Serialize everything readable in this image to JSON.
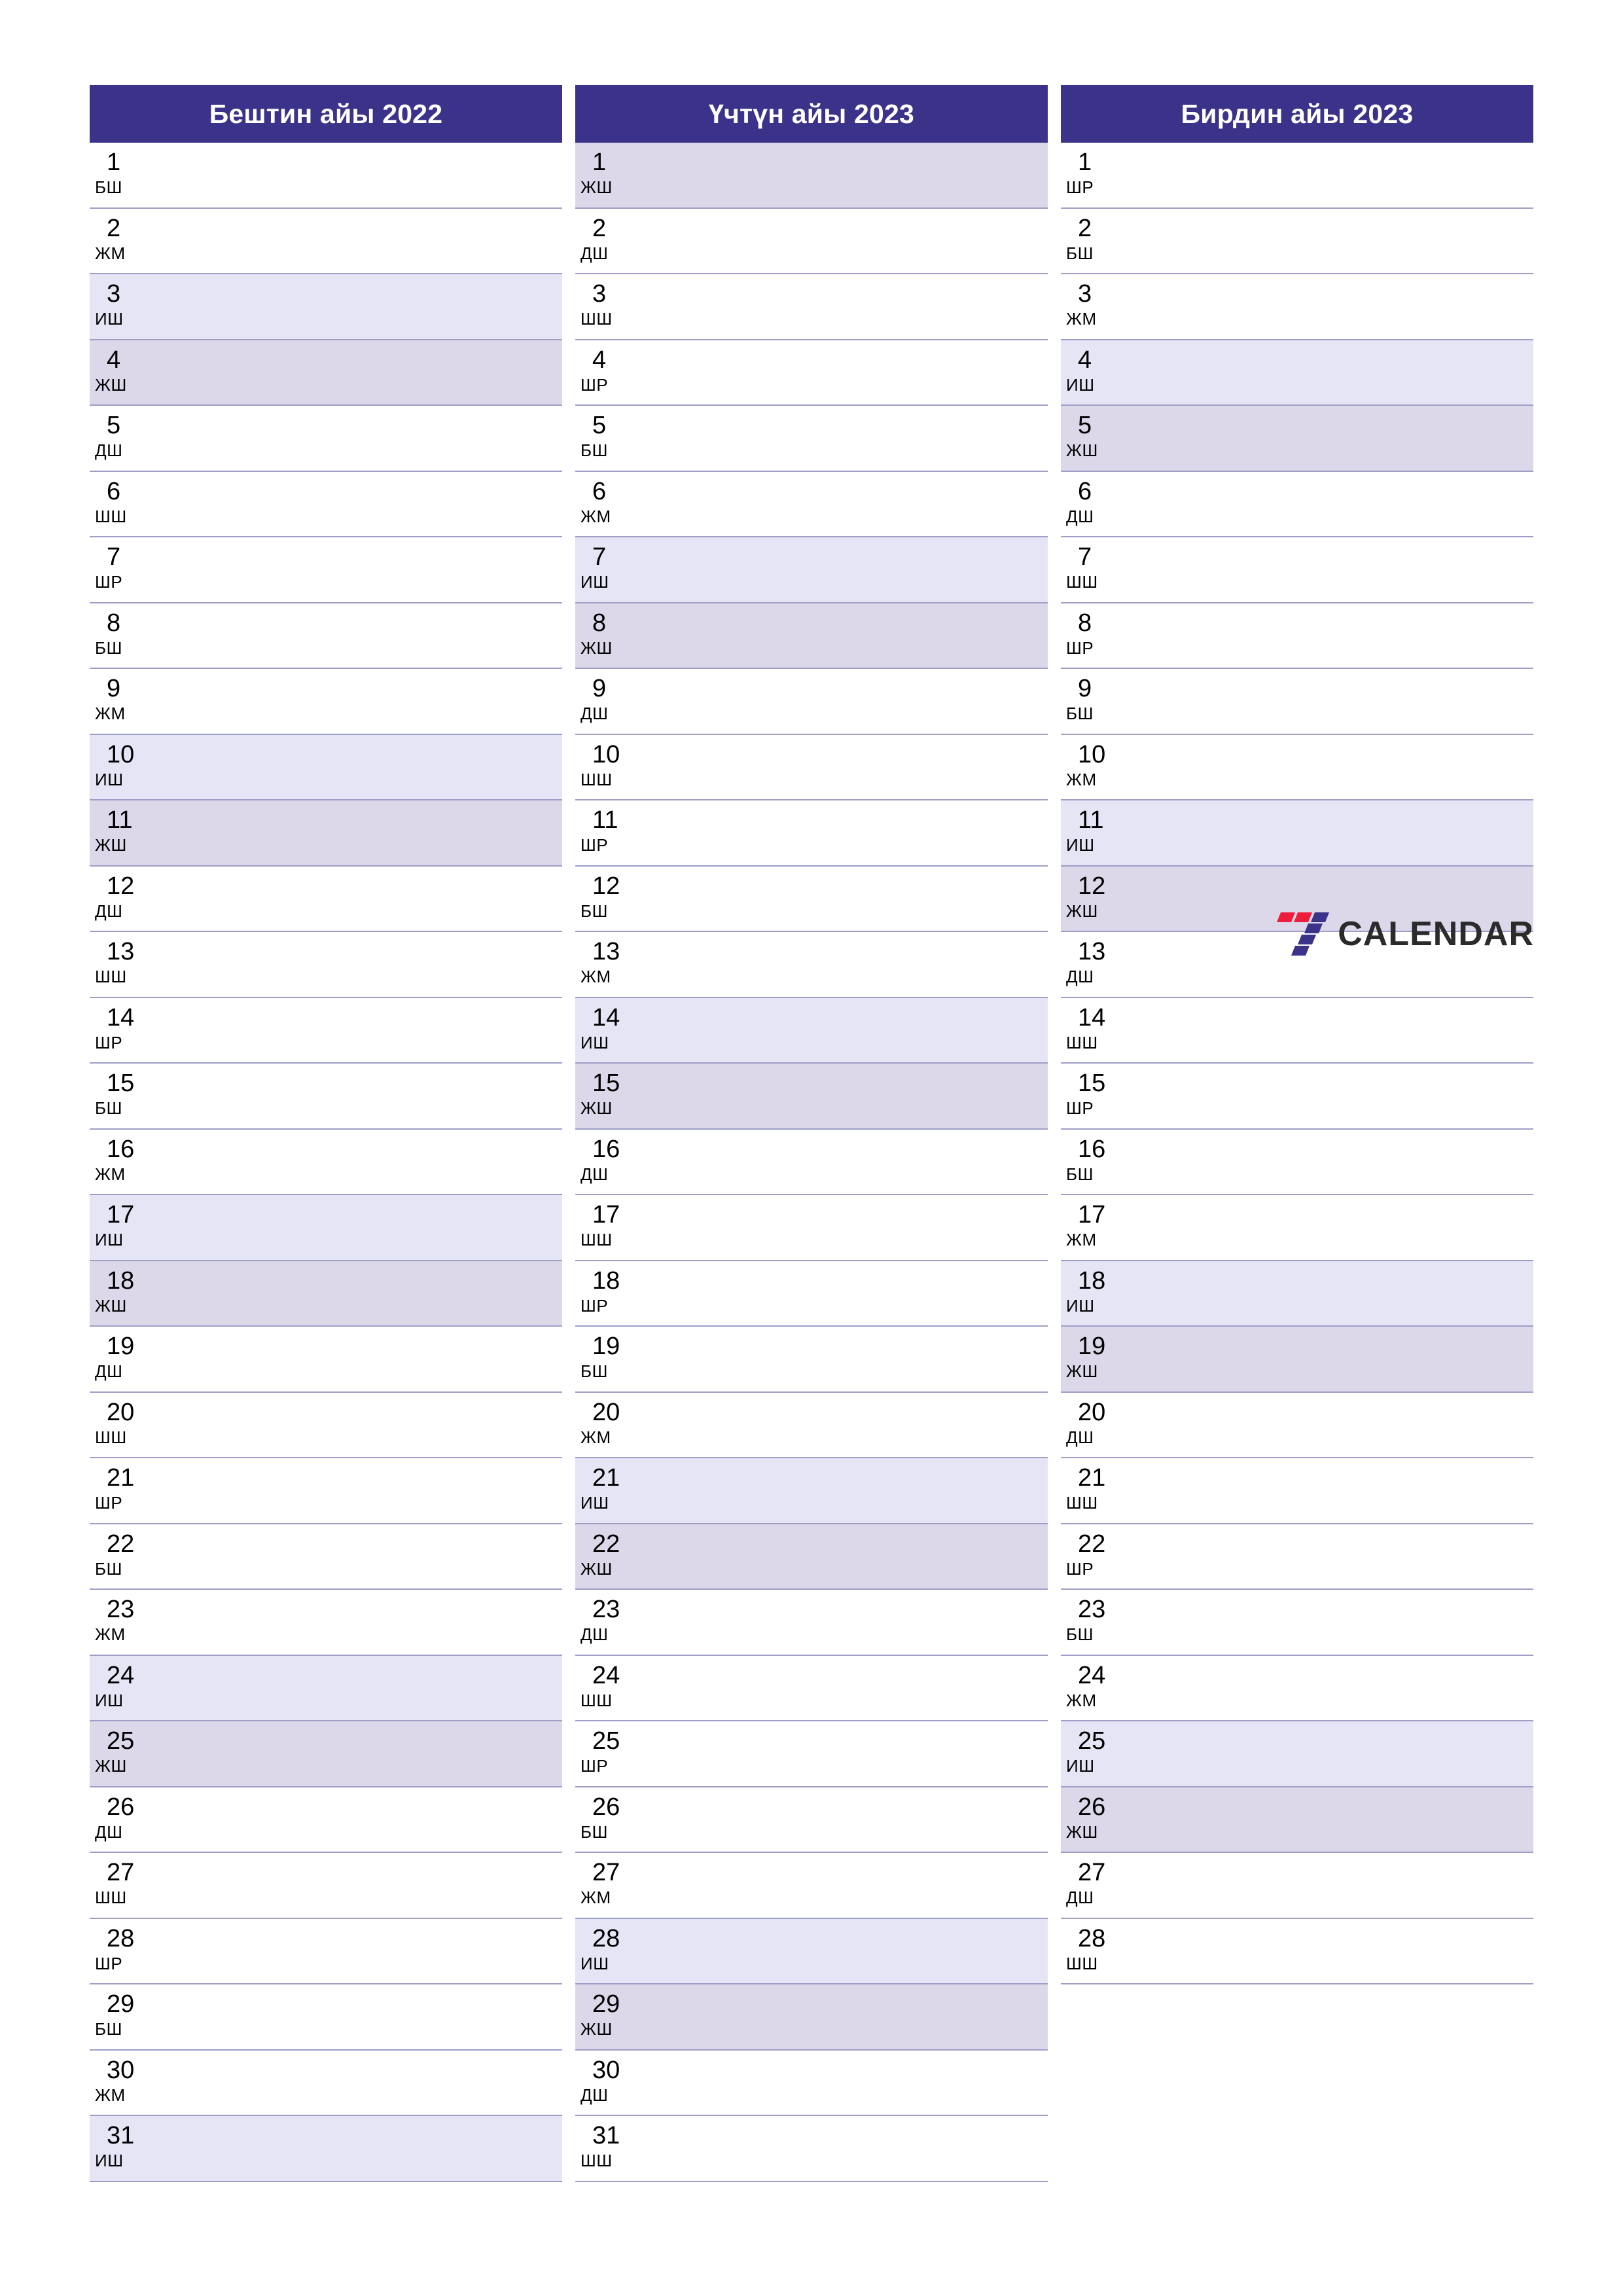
{
  "page": {
    "background": "#ffffff",
    "header_color": "#3b3289",
    "saturday_color": "#e5e5f6",
    "sunday_color": "#dcd8ea",
    "rule_color": "#9e9ec8"
  },
  "brand": {
    "name": "CALENDAR",
    "mark_name": "seven-logo-icon",
    "mark_colors": [
      "#ee1d3c",
      "#3b3289"
    ]
  },
  "months": [
    {
      "title": "Бештин айы 2022",
      "days": [
        {
          "num": "1",
          "abbr": "БШ",
          "type": "weekday"
        },
        {
          "num": "2",
          "abbr": "ЖМ",
          "type": "weekday"
        },
        {
          "num": "3",
          "abbr": "ИШ",
          "type": "sat"
        },
        {
          "num": "4",
          "abbr": "ЖШ",
          "type": "sun"
        },
        {
          "num": "5",
          "abbr": "ДШ",
          "type": "weekday"
        },
        {
          "num": "6",
          "abbr": "ШШ",
          "type": "weekday"
        },
        {
          "num": "7",
          "abbr": "ШР",
          "type": "weekday"
        },
        {
          "num": "8",
          "abbr": "БШ",
          "type": "weekday"
        },
        {
          "num": "9",
          "abbr": "ЖМ",
          "type": "weekday"
        },
        {
          "num": "10",
          "abbr": "ИШ",
          "type": "sat"
        },
        {
          "num": "11",
          "abbr": "ЖШ",
          "type": "sun"
        },
        {
          "num": "12",
          "abbr": "ДШ",
          "type": "weekday"
        },
        {
          "num": "13",
          "abbr": "ШШ",
          "type": "weekday"
        },
        {
          "num": "14",
          "abbr": "ШР",
          "type": "weekday"
        },
        {
          "num": "15",
          "abbr": "БШ",
          "type": "weekday"
        },
        {
          "num": "16",
          "abbr": "ЖМ",
          "type": "weekday"
        },
        {
          "num": "17",
          "abbr": "ИШ",
          "type": "sat"
        },
        {
          "num": "18",
          "abbr": "ЖШ",
          "type": "sun"
        },
        {
          "num": "19",
          "abbr": "ДШ",
          "type": "weekday"
        },
        {
          "num": "20",
          "abbr": "ШШ",
          "type": "weekday"
        },
        {
          "num": "21",
          "abbr": "ШР",
          "type": "weekday"
        },
        {
          "num": "22",
          "abbr": "БШ",
          "type": "weekday"
        },
        {
          "num": "23",
          "abbr": "ЖМ",
          "type": "weekday"
        },
        {
          "num": "24",
          "abbr": "ИШ",
          "type": "sat"
        },
        {
          "num": "25",
          "abbr": "ЖШ",
          "type": "sun"
        },
        {
          "num": "26",
          "abbr": "ДШ",
          "type": "weekday"
        },
        {
          "num": "27",
          "abbr": "ШШ",
          "type": "weekday"
        },
        {
          "num": "28",
          "abbr": "ШР",
          "type": "weekday"
        },
        {
          "num": "29",
          "abbr": "БШ",
          "type": "weekday"
        },
        {
          "num": "30",
          "abbr": "ЖМ",
          "type": "weekday"
        },
        {
          "num": "31",
          "abbr": "ИШ",
          "type": "sat"
        }
      ]
    },
    {
      "title": "Үчтүн айы 2023",
      "days": [
        {
          "num": "1",
          "abbr": "ЖШ",
          "type": "sun"
        },
        {
          "num": "2",
          "abbr": "ДШ",
          "type": "weekday"
        },
        {
          "num": "3",
          "abbr": "ШШ",
          "type": "weekday"
        },
        {
          "num": "4",
          "abbr": "ШР",
          "type": "weekday"
        },
        {
          "num": "5",
          "abbr": "БШ",
          "type": "weekday"
        },
        {
          "num": "6",
          "abbr": "ЖМ",
          "type": "weekday"
        },
        {
          "num": "7",
          "abbr": "ИШ",
          "type": "sat"
        },
        {
          "num": "8",
          "abbr": "ЖШ",
          "type": "sun"
        },
        {
          "num": "9",
          "abbr": "ДШ",
          "type": "weekday"
        },
        {
          "num": "10",
          "abbr": "ШШ",
          "type": "weekday"
        },
        {
          "num": "11",
          "abbr": "ШР",
          "type": "weekday"
        },
        {
          "num": "12",
          "abbr": "БШ",
          "type": "weekday"
        },
        {
          "num": "13",
          "abbr": "ЖМ",
          "type": "weekday"
        },
        {
          "num": "14",
          "abbr": "ИШ",
          "type": "sat"
        },
        {
          "num": "15",
          "abbr": "ЖШ",
          "type": "sun"
        },
        {
          "num": "16",
          "abbr": "ДШ",
          "type": "weekday"
        },
        {
          "num": "17",
          "abbr": "ШШ",
          "type": "weekday"
        },
        {
          "num": "18",
          "abbr": "ШР",
          "type": "weekday"
        },
        {
          "num": "19",
          "abbr": "БШ",
          "type": "weekday"
        },
        {
          "num": "20",
          "abbr": "ЖМ",
          "type": "weekday"
        },
        {
          "num": "21",
          "abbr": "ИШ",
          "type": "sat"
        },
        {
          "num": "22",
          "abbr": "ЖШ",
          "type": "sun"
        },
        {
          "num": "23",
          "abbr": "ДШ",
          "type": "weekday"
        },
        {
          "num": "24",
          "abbr": "ШШ",
          "type": "weekday"
        },
        {
          "num": "25",
          "abbr": "ШР",
          "type": "weekday"
        },
        {
          "num": "26",
          "abbr": "БШ",
          "type": "weekday"
        },
        {
          "num": "27",
          "abbr": "ЖМ",
          "type": "weekday"
        },
        {
          "num": "28",
          "abbr": "ИШ",
          "type": "sat"
        },
        {
          "num": "29",
          "abbr": "ЖШ",
          "type": "sun"
        },
        {
          "num": "30",
          "abbr": "ДШ",
          "type": "weekday"
        },
        {
          "num": "31",
          "abbr": "ШШ",
          "type": "weekday"
        }
      ]
    },
    {
      "title": "Бирдин айы 2023",
      "days": [
        {
          "num": "1",
          "abbr": "ШР",
          "type": "weekday"
        },
        {
          "num": "2",
          "abbr": "БШ",
          "type": "weekday"
        },
        {
          "num": "3",
          "abbr": "ЖМ",
          "type": "weekday"
        },
        {
          "num": "4",
          "abbr": "ИШ",
          "type": "sat"
        },
        {
          "num": "5",
          "abbr": "ЖШ",
          "type": "sun"
        },
        {
          "num": "6",
          "abbr": "ДШ",
          "type": "weekday"
        },
        {
          "num": "7",
          "abbr": "ШШ",
          "type": "weekday"
        },
        {
          "num": "8",
          "abbr": "ШР",
          "type": "weekday"
        },
        {
          "num": "9",
          "abbr": "БШ",
          "type": "weekday"
        },
        {
          "num": "10",
          "abbr": "ЖМ",
          "type": "weekday"
        },
        {
          "num": "11",
          "abbr": "ИШ",
          "type": "sat"
        },
        {
          "num": "12",
          "abbr": "ЖШ",
          "type": "sun"
        },
        {
          "num": "13",
          "abbr": "ДШ",
          "type": "weekday"
        },
        {
          "num": "14",
          "abbr": "ШШ",
          "type": "weekday"
        },
        {
          "num": "15",
          "abbr": "ШР",
          "type": "weekday"
        },
        {
          "num": "16",
          "abbr": "БШ",
          "type": "weekday"
        },
        {
          "num": "17",
          "abbr": "ЖМ",
          "type": "weekday"
        },
        {
          "num": "18",
          "abbr": "ИШ",
          "type": "sat"
        },
        {
          "num": "19",
          "abbr": "ЖШ",
          "type": "sun"
        },
        {
          "num": "20",
          "abbr": "ДШ",
          "type": "weekday"
        },
        {
          "num": "21",
          "abbr": "ШШ",
          "type": "weekday"
        },
        {
          "num": "22",
          "abbr": "ШР",
          "type": "weekday"
        },
        {
          "num": "23",
          "abbr": "БШ",
          "type": "weekday"
        },
        {
          "num": "24",
          "abbr": "ЖМ",
          "type": "weekday"
        },
        {
          "num": "25",
          "abbr": "ИШ",
          "type": "sat"
        },
        {
          "num": "26",
          "abbr": "ЖШ",
          "type": "sun"
        },
        {
          "num": "27",
          "abbr": "ДШ",
          "type": "weekday"
        },
        {
          "num": "28",
          "abbr": "ШШ",
          "type": "weekday"
        }
      ]
    }
  ]
}
